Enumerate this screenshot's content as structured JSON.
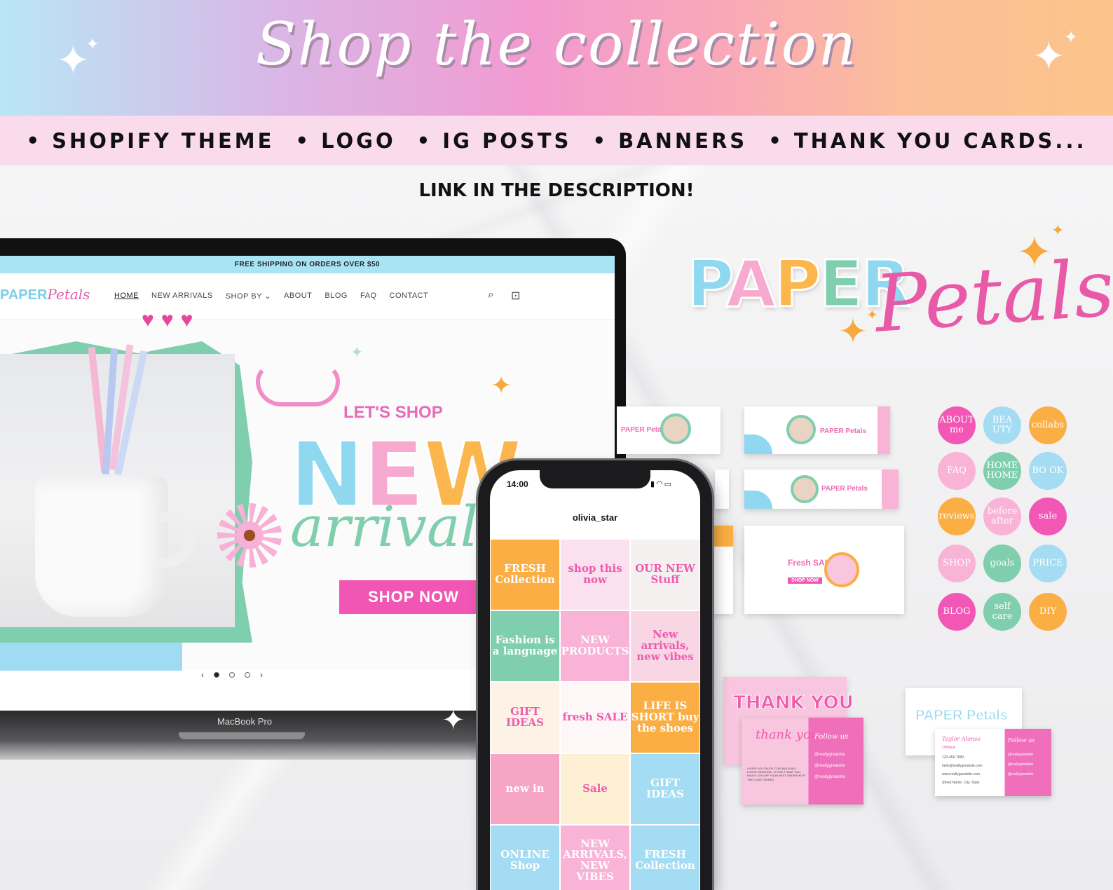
{
  "banner": {
    "title": "Shop the collection",
    "items": [
      "• SHOPIFY THEME",
      "• LOGO",
      "• IG POSTS",
      "• BANNERS",
      "• THANK YOU CARDS..."
    ],
    "link_text": "LINK IN THE DESCRIPTION!"
  },
  "laptop": {
    "shipping_bar": "FREE SHIPPING ON ORDERS OVER $50",
    "logo_paper": "PAPER",
    "logo_petals": "Petals",
    "nav": [
      "HOME",
      "NEW ARRIVALS",
      "SHOP BY ⌄",
      "ABOUT",
      "BLOG",
      "FAQ",
      "CONTACT"
    ],
    "icons": [
      "search-icon",
      "cart-icon"
    ],
    "hero_kicker": "LET'S SHOP",
    "hero_new": [
      "N",
      "E",
      "W"
    ],
    "hero_script": "arrivals",
    "cta": "SHOP NOW",
    "slider_prev": "‹",
    "slider_next": "›",
    "device_label": "MacBook Pro"
  },
  "logo": {
    "paper": [
      "P",
      "A",
      "P",
      "E",
      "R"
    ],
    "script": "Petals"
  },
  "highlights": [
    {
      "label": "ABOUT me",
      "color": "#f357b5"
    },
    {
      "label": "BEA UTY",
      "color": "#a4dcf3"
    },
    {
      "label": "collabs",
      "color": "#fbae44"
    },
    {
      "label": "FAQ",
      "color": "#f8b3d6"
    },
    {
      "label": "HOME HOME",
      "color": "#7fcfae"
    },
    {
      "label": "BO OK",
      "color": "#a4dcf3"
    },
    {
      "label": "reviews",
      "color": "#fbae44"
    },
    {
      "label": "before after",
      "color": "#f8b3d6"
    },
    {
      "label": "sale",
      "color": "#f357b5"
    },
    {
      "label": "SHOP",
      "color": "#f8b3d6"
    },
    {
      "label": "goals",
      "color": "#7fcfae"
    },
    {
      "label": "PRICE",
      "color": "#a4dcf3"
    },
    {
      "label": "BLOG",
      "color": "#f357b5"
    },
    {
      "label": "self care",
      "color": "#7fcfae"
    },
    {
      "label": "DIY",
      "color": "#fbae44"
    }
  ],
  "thank_you": {
    "title": "THANK YOU",
    "script": "thank you",
    "follow": "Follow us",
    "handles": [
      "@reallygreatsite",
      "@reallygreatsite",
      "@reallygreatsite"
    ],
    "message": "I HOPE YOU ENJOY IT AS MUCH AS I LOVED CREATING. TO SAY THANK YOU, ENJOY 10% OFF YOUR NEXT ORDER WITH THE CODE THANKS"
  },
  "business_card": {
    "logo": "PAPER Petals",
    "name": "Taylor Alonso",
    "role": "OWNER",
    "phone": "123-456-7890",
    "email": "hello@reallygreatsite.com",
    "site": "www.reallygreatsite.com",
    "address": "Street Name, City, State",
    "follow": "Follow us",
    "handles": [
      "@reallygreatsite",
      "@reallygreatsite",
      "@reallygreatsite"
    ]
  },
  "phone": {
    "time": "14:00",
    "username": "olivia_star",
    "tiles": [
      {
        "text": "FRESH Collection",
        "bg": "#fbae44"
      },
      {
        "text": "shop this now",
        "bg": "#fbe0ef"
      },
      {
        "text": "OUR NEW Stuff",
        "bg": "#f4f0f0"
      },
      {
        "text": "Fashion is a language",
        "bg": "#7fcfae"
      },
      {
        "text": "NEW PRODUCTS",
        "bg": "#f8b3d6"
      },
      {
        "text": "New arrivals, new vibes",
        "bg": "#f8d6e4"
      },
      {
        "text": "GIFT IDEAS",
        "bg": "#fdf2e6"
      },
      {
        "text": "fresh SALE",
        "bg": "#fdf7f8"
      },
      {
        "text": "LIFE IS SHORT buy the shoes",
        "bg": "#fbae44"
      },
      {
        "text": "new in",
        "bg": "#f6a5c4"
      },
      {
        "text": "Sale",
        "bg": "#fdf0d4"
      },
      {
        "text": "GIFT IDEAS",
        "bg": "#a4dcf3"
      },
      {
        "text": "ONLINE Shop",
        "bg": "#a4dcf3"
      },
      {
        "text": "NEW ARRIVALS, NEW VIBES",
        "bg": "#f8b3d6"
      },
      {
        "text": "FRESH Collection",
        "bg": "#a4dcf3"
      }
    ]
  },
  "banner_cards": [
    {
      "logo": "PAPER Petals"
    },
    {
      "logo": "PAPER Petals"
    },
    {
      "logo": "PAPER Petals"
    },
    {
      "logo": "Fresh SALE",
      "button": "SHOP NOW"
    }
  ]
}
